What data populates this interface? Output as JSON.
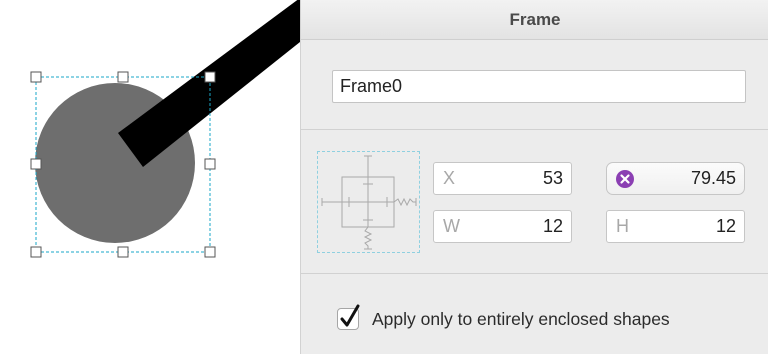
{
  "inspector": {
    "title": "Frame",
    "name_value": "Frame0",
    "x_label": "X",
    "x_value": "53",
    "y_value": "79.45",
    "w_label": "W",
    "w_value": "12",
    "h_label": "H",
    "h_value": "12",
    "checkbox_label": "Apply only to entirely enclosed shapes",
    "checkbox_checked": true
  },
  "icons": {
    "y_field_icon": "clear-x-icon",
    "autoresize": "autoresizing-springs-icon",
    "checkmark": "checkmark-icon"
  },
  "colors": {
    "circle": "#6e6e6e",
    "bar": "#000000",
    "selection": "#1aa7c8",
    "clear_icon": "#8b3fb3"
  }
}
